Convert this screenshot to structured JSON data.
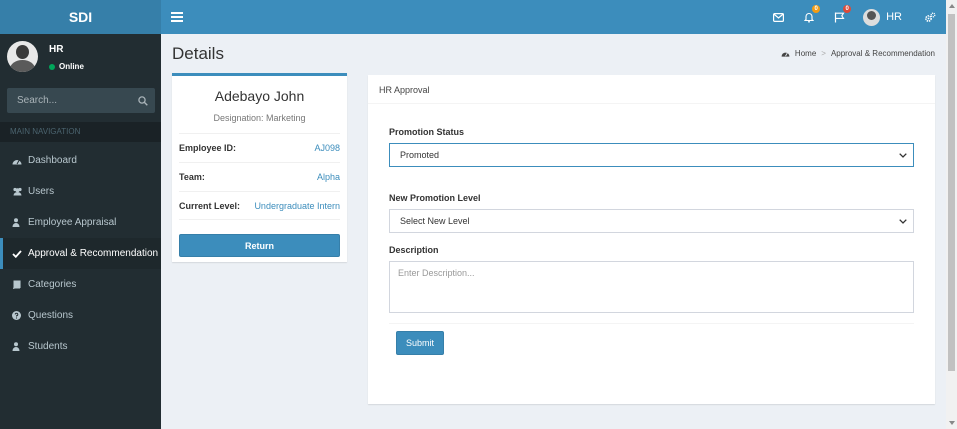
{
  "header": {
    "logo": "SDI",
    "notifications_count": "0",
    "flags_count": "0",
    "user_name": "HR",
    "icons": [
      "menu-icon",
      "envelope-icon",
      "bell-icon",
      "flag-icon",
      "cogs-icon"
    ]
  },
  "sidebar": {
    "user": {
      "name": "HR",
      "status": "Online"
    },
    "search_placeholder": "Search...",
    "nav_header": "MAIN NAVIGATION",
    "items": [
      {
        "label": "Dashboard",
        "icon": "dashboard-icon"
      },
      {
        "label": "Users",
        "icon": "users-icon"
      },
      {
        "label": "Employee Appraisal",
        "icon": "user-icon"
      },
      {
        "label": "Approval & Recommendation",
        "icon": "check-icon",
        "active": true
      },
      {
        "label": "Categories",
        "icon": "book-icon"
      },
      {
        "label": "Questions",
        "icon": "question-icon"
      },
      {
        "label": "Students",
        "icon": "user-icon"
      }
    ]
  },
  "page": {
    "title": "Details",
    "breadcrumb": {
      "home": "Home",
      "current": "Approval & Recommendation"
    }
  },
  "profile": {
    "name": "Adebayo John",
    "designation": "Designation: Marketing",
    "fields": [
      {
        "label": "Employee ID:",
        "value": "AJ098"
      },
      {
        "label": "Team:",
        "value": "Alpha"
      },
      {
        "label": "Current Level:",
        "value": "Undergraduate Intern"
      }
    ],
    "return_label": "Return"
  },
  "approval": {
    "title": "HR Approval",
    "promotion_status_label": "Promotion Status",
    "promotion_status_value": "Promoted",
    "new_level_label": "New Promotion Level",
    "new_level_value": "Select New Level",
    "description_label": "Description",
    "description_placeholder": "Enter Description...",
    "submit_label": "Submit"
  },
  "colors": {
    "primary": "#3c8dbc",
    "logo_bg": "#367fa9",
    "sidebar_bg": "#222d32",
    "content_bg": "#ecf0f5",
    "online": "#00a65a",
    "badge_warning": "#f39c12",
    "badge_danger": "#dd4b39"
  }
}
